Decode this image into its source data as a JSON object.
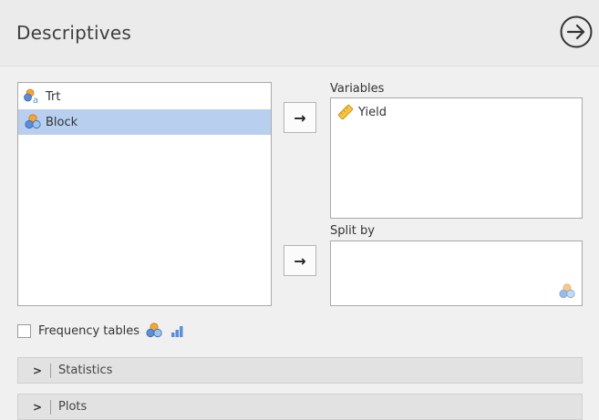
{
  "header": {
    "title": "Descriptives",
    "run_icon": "circle-arrow-right-icon"
  },
  "source_list": {
    "items": [
      {
        "label": "Trt",
        "icon": "nominal-text-variable-icon",
        "selected": false
      },
      {
        "label": "Block",
        "icon": "nominal-variable-icon",
        "selected": true
      }
    ]
  },
  "move_buttons": {
    "glyph": "→"
  },
  "variables": {
    "label": "Variables",
    "items": [
      {
        "label": "Yield",
        "icon": "continuous-variable-icon"
      }
    ]
  },
  "split_by": {
    "label": "Split by",
    "hint_icon": "nominal-variable-icon"
  },
  "frequency_tables": {
    "label": "Frequency tables",
    "checked": false,
    "icons": [
      "nominal-variable-icon",
      "ordinal-variable-icon"
    ]
  },
  "sections": [
    {
      "label": "Statistics",
      "expanded": false
    },
    {
      "label": "Plots",
      "expanded": false
    }
  ],
  "colors": {
    "selected_bg": "#b9cff0",
    "nominal_orange": "#f3a53a",
    "nominal_blue": "#5b8ed6",
    "continuous_yellow": "#f5c542"
  }
}
